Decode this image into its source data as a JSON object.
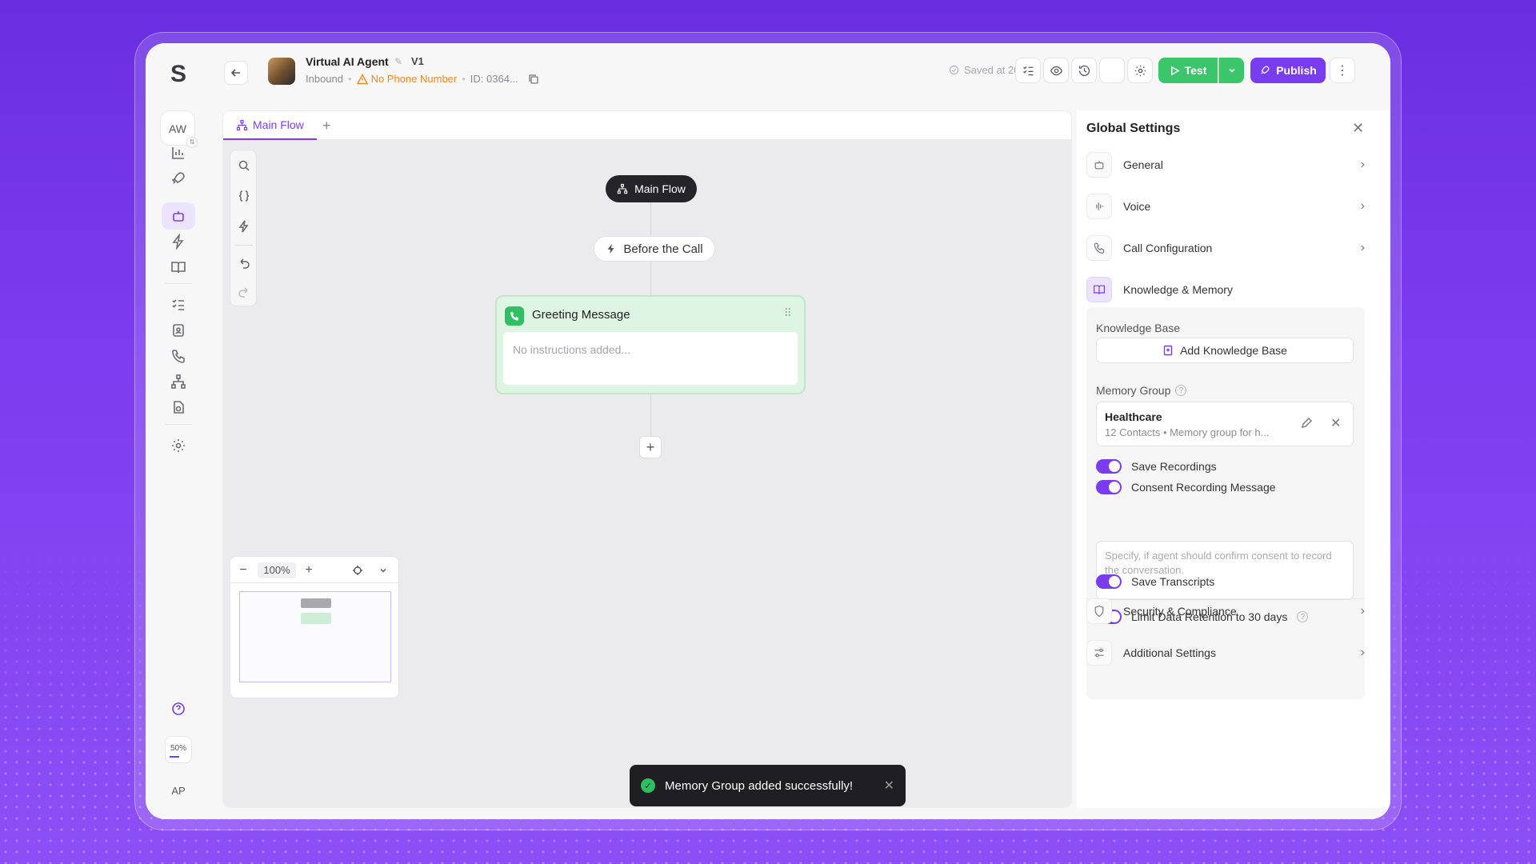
{
  "rail": {
    "logo": "S",
    "workspace_initials": "AW",
    "zoom": "50%",
    "user_initials": "AP",
    "active_item": "agents"
  },
  "header": {
    "agent_name": "Virtual AI Agent",
    "version": "V1",
    "direction": "Inbound",
    "warning": "No Phone Number",
    "id": "ID: 0364...",
    "saved": "Saved at 20:43",
    "test_label": "Test",
    "publish_label": "Publish"
  },
  "tabs": {
    "main_flow": "Main Flow"
  },
  "canvas": {
    "main_flow_node": "Main Flow",
    "before_call_node": "Before the Call",
    "greeting_title": "Greeting Message",
    "greeting_placeholder": "No instructions added...",
    "zoom": "100%"
  },
  "toast": {
    "message": "Memory Group added successfully!"
  },
  "panel": {
    "title": "Global Settings",
    "sections": {
      "general": "General",
      "voice": "Voice",
      "call_configuration": "Call Configuration",
      "knowledge_memory": "Knowledge & Memory",
      "security": "Security & Compliance",
      "additional": "Additional Settings"
    },
    "knowledge_base_label": "Knowledge Base",
    "add_knowledge_base": "Add Knowledge Base",
    "memory_group_label": "Memory Group",
    "memory_group_name": "Healthcare",
    "memory_group_sub": "12 Contacts • Memory group for h...",
    "save_recordings": "Save Recordings",
    "consent_recording": "Consent Recording Message",
    "consent_placeholder": "Specify, if agent should confirm consent to record the conversation.",
    "save_transcripts": "Save Transcripts",
    "limit_retention": "Limit Data Retention to 30 days"
  },
  "colors": {
    "accent": "#7a3cf0",
    "success": "#3cc66b",
    "warning": "#f08a24"
  }
}
